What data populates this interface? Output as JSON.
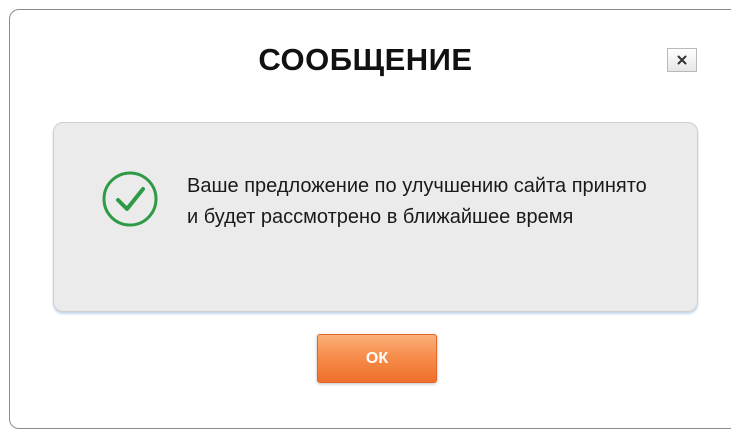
{
  "dialog": {
    "title": "СООБЩЕНИЕ",
    "close_icon": "close-icon",
    "message": "Ваше предложение по улучшению сайта принято и будет рассмотрено в ближайшее время",
    "status_icon": "check-circle-icon",
    "ok_label": "ОК"
  },
  "colors": {
    "success_green": "#2e9a46",
    "ok_button": "#f0782f",
    "message_bg": "#ebebeb"
  }
}
